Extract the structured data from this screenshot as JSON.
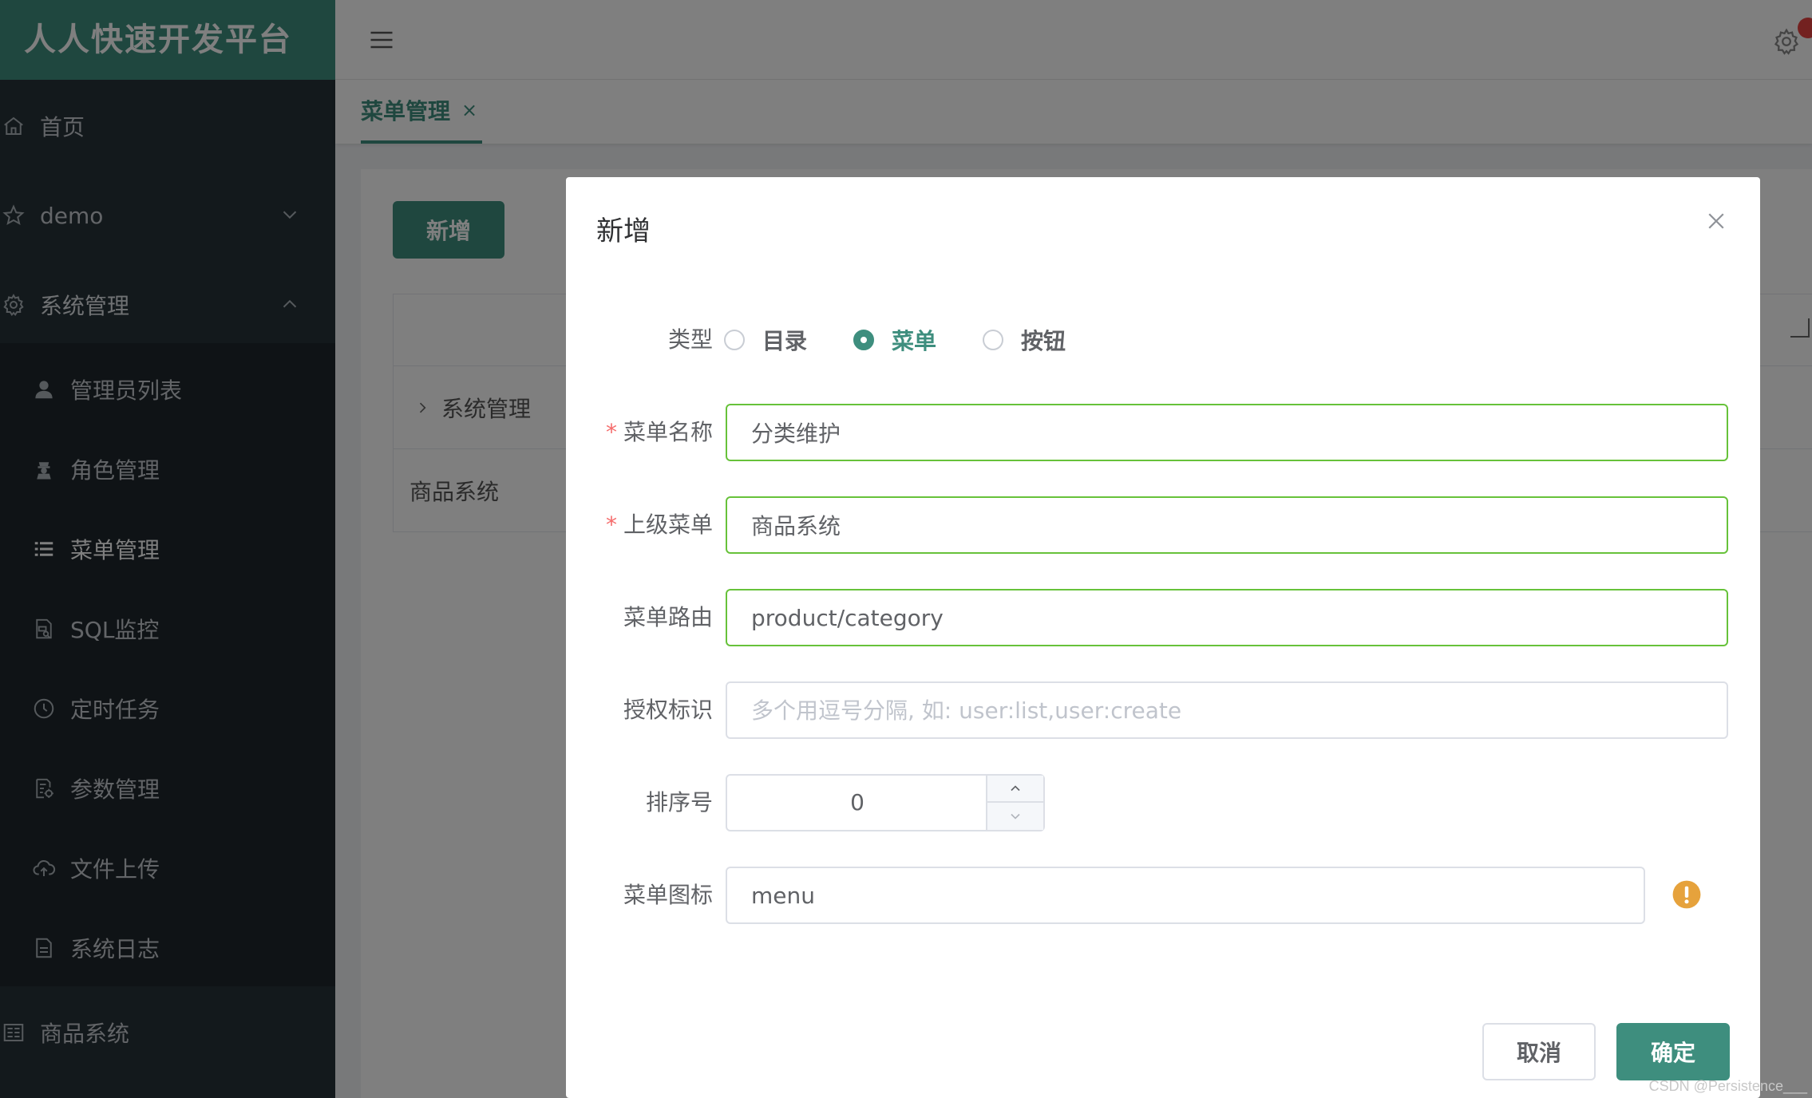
{
  "app": {
    "title": "人人快速开发平台"
  },
  "sidebar": {
    "items": [
      {
        "label": "首页",
        "icon": "home-icon"
      },
      {
        "label": "demo",
        "icon": "star-icon"
      },
      {
        "label": "系统管理",
        "icon": "gear-icon"
      },
      {
        "label": "管理员列表",
        "icon": "user-icon"
      },
      {
        "label": "角色管理",
        "icon": "role-icon"
      },
      {
        "label": "菜单管理",
        "icon": "list-icon"
      },
      {
        "label": "SQL监控",
        "icon": "sql-icon"
      },
      {
        "label": "定时任务",
        "icon": "clock-icon"
      },
      {
        "label": "参数管理",
        "icon": "params-icon"
      },
      {
        "label": "文件上传",
        "icon": "cloud-upload-icon"
      },
      {
        "label": "系统日志",
        "icon": "document-icon"
      },
      {
        "label": "商品系统",
        "icon": "product-icon"
      }
    ]
  },
  "tabs": [
    {
      "label": "菜单管理",
      "close": "×"
    }
  ],
  "content": {
    "add_button": "新增",
    "table_rows": [
      "系统管理",
      "商品系统"
    ]
  },
  "dialog": {
    "title": "新增",
    "type": {
      "label": "类型",
      "options": [
        "目录",
        "菜单",
        "按钮"
      ],
      "selected": "菜单"
    },
    "name": {
      "label": "菜单名称",
      "value": "分类维护",
      "required": true
    },
    "parent": {
      "label": "上级菜单",
      "value": "商品系统",
      "required": true
    },
    "url": {
      "label": "菜单路由",
      "value": "product/category"
    },
    "perms": {
      "label": "授权标识",
      "placeholder": "多个用逗号分隔, 如: user:list,user:create"
    },
    "order": {
      "label": "排序号",
      "value": "0"
    },
    "icon": {
      "label": "菜单图标",
      "value": "menu"
    },
    "cancel_label": "取消",
    "confirm_label": "确定",
    "required_mark": "*"
  },
  "watermark": "CSDN @Persistence___",
  "colors": {
    "accent": "#3e8e7e",
    "sidebar_bg": "#263238",
    "valid_border": "#67c23a",
    "warning": "#e6a23c"
  }
}
